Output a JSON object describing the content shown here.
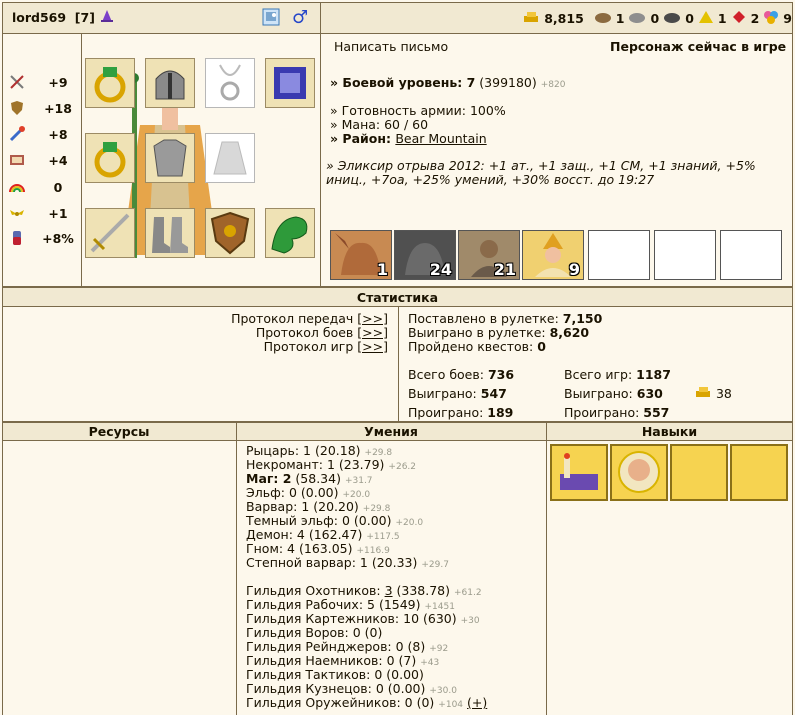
{
  "header": {
    "nick": "lord569",
    "level": "[7]",
    "icons": [
      "mage-hat-icon",
      "photo-icon",
      "male-icon"
    ]
  },
  "resources_top": [
    {
      "icon": "gold-icon",
      "value": "8,815",
      "color": "#d9a400"
    },
    {
      "icon": "wood-icon",
      "value": "1",
      "color": "#8b6a3f"
    },
    {
      "icon": "ore-icon",
      "value": "0",
      "color": "#7a7a7a"
    },
    {
      "icon": "mercury-icon",
      "value": "0",
      "color": "#555555"
    },
    {
      "icon": "sulfur-icon",
      "value": "1",
      "color": "#e4c200"
    },
    {
      "icon": "crystal-icon",
      "value": "2",
      "color": "#d0202a"
    },
    {
      "icon": "gems-icon",
      "value": "9",
      "color": "#d08000"
    }
  ],
  "stats": [
    {
      "icon": "sword-icon",
      "value": "+9"
    },
    {
      "icon": "shield-icon",
      "value": "+18"
    },
    {
      "icon": "wand-icon",
      "value": "+8"
    },
    {
      "icon": "book-icon",
      "value": "+4"
    },
    {
      "icon": "rainbow-icon",
      "value": "0"
    },
    {
      "icon": "wings-icon",
      "value": "+1"
    },
    {
      "icon": "potion-icon",
      "value": "+8%"
    }
  ],
  "equipment": [
    "ring-icon",
    "helmet-icon",
    "amulet-icon",
    "spellbook-icon",
    "ring-icon",
    "armor-icon",
    "cloak-icon",
    "sword-icon",
    "boots-icon",
    "shield-icon",
    "dragon-icon"
  ],
  "info": {
    "write_letter": "Написать письмо",
    "online_status": "Персонаж сейчас в игре",
    "combat_label": "» Боевой уровень: 7",
    "combat_exp": "(399180)",
    "combat_extra": "+820",
    "army_ready": "» Готовность армии: 100%",
    "mana": "» Мана: 60 / 60",
    "region_label": "» Район: ",
    "region_value": "Bear Mountain",
    "elixir": "» Эликсир отрыва 2012: +1 ат., +1 защ., +1 СМ, +1 знаний, +5% иниц., +7оа, +25% умений, +30% восст. до 19:27"
  },
  "army": [
    {
      "name": "gargoyle",
      "count": "1"
    },
    {
      "name": "golem",
      "count": "24"
    },
    {
      "name": "mage",
      "count": "21"
    },
    {
      "name": "archmage",
      "count": "9"
    },
    {
      "name": "empty",
      "count": ""
    },
    {
      "name": "empty",
      "count": ""
    },
    {
      "name": "empty",
      "count": ""
    }
  ],
  "statistics": {
    "title": "Статистика",
    "protocols": [
      {
        "label": "Протокол передач",
        "link": "[>>]"
      },
      {
        "label": "Протокол боев",
        "link": "[>>]"
      },
      {
        "label": "Протокол игр",
        "link": "[>>]"
      }
    ],
    "roulette_bet_label": "Поставлено в рулетке: ",
    "roulette_bet": "7,150",
    "roulette_won_label": "Выиграно в рулетке: ",
    "roulette_won": "8,620",
    "quests_label": "Пройдено квестов: ",
    "quests": "0",
    "battles_total_label": "Всего боев: ",
    "battles_total": "736",
    "battles_won_label": "Выиграно: ",
    "battles_won": "547",
    "battles_lost_label": "Проиграно: ",
    "battles_lost": "189",
    "games_total_label": "Всего игр: ",
    "games_total": "1187",
    "games_won_label": "Выиграно: ",
    "games_won": "630",
    "games_gold": "38",
    "games_lost_label": "Проиграно: ",
    "games_lost": "557"
  },
  "columns": {
    "resources": "Ресурсы",
    "skills": "Умения",
    "perks": "Навыки"
  },
  "factions": [
    {
      "name": "Рыцарь: 1 ",
      "value": "(20.18)",
      "extra": "+29.8"
    },
    {
      "name": "Некромант: 1 ",
      "value": "(23.79)",
      "extra": "+26.2"
    },
    {
      "name": "Маг: 2",
      "value": " (58.34)",
      "extra": "+31.7",
      "bold": true
    },
    {
      "name": "Эльф: 0 ",
      "value": "(0.00)",
      "extra": "+20.0"
    },
    {
      "name": "Варвар: 1 ",
      "value": "(20.20)",
      "extra": "+29.8"
    },
    {
      "name": "Темный эльф: 0 ",
      "value": "(0.00)",
      "extra": "+20.0"
    },
    {
      "name": "Демон: 4 ",
      "value": "(162.47)",
      "extra": "+117.5"
    },
    {
      "name": "Гном: 4 ",
      "value": "(163.05)",
      "extra": "+116.9"
    },
    {
      "name": "Степной варвар: 1 ",
      "value": "(20.33)",
      "extra": "+29.7"
    }
  ],
  "guilds": [
    {
      "name": "Гильдия Охотников: ",
      "level": "3",
      "value": " (338.78)",
      "extra": "+61.2",
      "underline": true
    },
    {
      "name": "Гильдия Рабочих: 5 ",
      "level": "",
      "value": "(1549)",
      "extra": "+1451"
    },
    {
      "name": "Гильдия Картежников: 10 ",
      "level": "",
      "value": "(630)",
      "extra": "+30"
    },
    {
      "name": "Гильдия Воров: 0 ",
      "level": "",
      "value": "(0)",
      "extra": ""
    },
    {
      "name": "Гильдия Рейнджеров: 0 ",
      "level": "",
      "value": "(8)",
      "extra": "+92"
    },
    {
      "name": "Гильдия Наемников: 0 ",
      "level": "",
      "value": "(7)",
      "extra": "+43"
    },
    {
      "name": "Гильдия Тактиков: 0 ",
      "level": "",
      "value": "(0.00)",
      "extra": ""
    },
    {
      "name": "Гильдия Кузнецов: 0 ",
      "level": "",
      "value": "(0.00)",
      "extra": "+30.0"
    },
    {
      "name": "Гильдия Оружейников: 0 ",
      "level": "",
      "value": "(0)",
      "extra": "+104",
      "plus": "(+)"
    }
  ],
  "perks": [
    "scroll-icon",
    "bald-hero-icon",
    "empty",
    "empty"
  ]
}
